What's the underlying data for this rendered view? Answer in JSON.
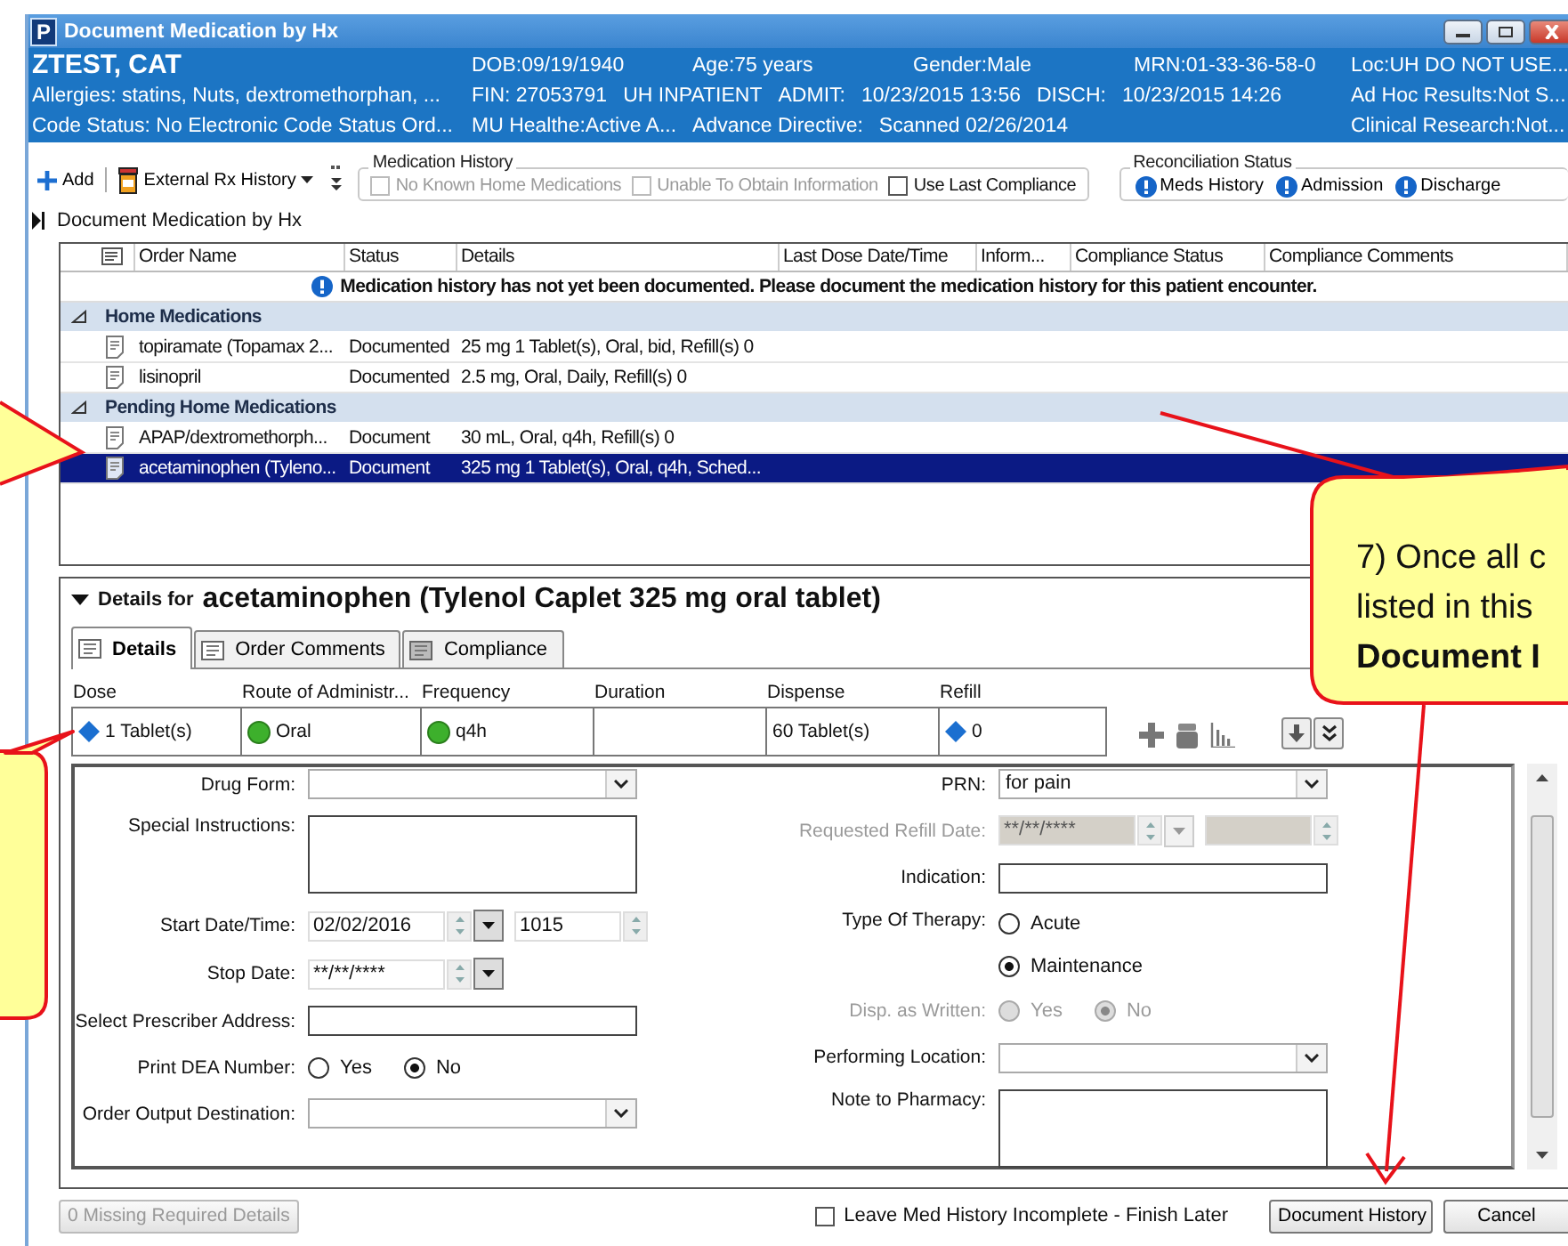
{
  "window": {
    "app_letter": "P",
    "title": "Document Medication by Hx"
  },
  "banner": {
    "rows": [
      {
        "left": "ZTEST, CAT",
        "items": [
          "DOB:09/19/1940",
          "Age:75 years",
          "Gender:Male",
          "MRN:01-33-36-58-0"
        ],
        "right": "Loc:UH DO NOT USE..."
      },
      {
        "left": "Allergies: statins, Nuts, dextromethorphan, ...",
        "items": [
          "FIN: 27053791",
          "UH INPATIENT",
          "ADMIT:",
          "10/23/2015 13:56",
          "DISCH:",
          "10/23/2015 14:26"
        ],
        "right": "Ad Hoc Results:Not S..."
      },
      {
        "left": "Code Status: No Electronic Code Status Ord...",
        "items": [
          "MU Healthe:Active A...",
          "Advance Directive:",
          "Scanned 02/26/2014"
        ],
        "right": "Clinical Research:Not..."
      }
    ]
  },
  "toolbar": {
    "add": "Add",
    "external": "External Rx History",
    "med_history": {
      "label": "Medication History",
      "options": [
        {
          "label": "No Known Home Medications",
          "checked": false,
          "disabled": true
        },
        {
          "label": "Unable To Obtain Information",
          "checked": false,
          "disabled": true
        },
        {
          "label": "Use Last Compliance",
          "checked": false,
          "disabled": false
        }
      ]
    },
    "reconciliation": {
      "label": "Reconciliation Status",
      "items": [
        "Meds History",
        "Admission",
        "Discharge"
      ]
    }
  },
  "breadcrumb": "Document Medication by Hx",
  "table": {
    "columns": [
      "Order Name",
      "Status",
      "Details",
      "Last Dose Date/Time",
      "Inform...",
      "Compliance Status",
      "Compliance Comments"
    ],
    "notice": "Medication history has not yet been documented. Please document the medication history for this patient encounter.",
    "groups": [
      {
        "name": "Home Medications",
        "expanded": true,
        "rows": [
          {
            "name": "topiramate (Topamax 2...",
            "status": "Documented",
            "details": "25 mg 1 Tablet(s), Oral, bid, Refill(s) 0",
            "selected": false
          },
          {
            "name": "lisinopril",
            "status": "Documented",
            "details": "2.5 mg, Oral, Daily, Refill(s) 0",
            "selected": false
          }
        ]
      },
      {
        "name": "Pending Home Medications",
        "expanded": true,
        "rows": [
          {
            "name": "APAP/dextromethorph...",
            "status": "Document",
            "details": "30 mL, Oral, q4h, Refill(s) 0",
            "selected": false
          },
          {
            "name": "acetaminophen (Tyleno...",
            "status": "Document",
            "details": "325 mg 1 Tablet(s), Oral, q4h, Sched...",
            "selected": true
          }
        ]
      }
    ]
  },
  "details": {
    "prefix": "Details for",
    "heading": "acetaminophen (Tylenol Caplet 325 mg oral tablet)",
    "tabs": [
      {
        "label": "Details",
        "selected": true
      },
      {
        "label": "Order Comments",
        "selected": false
      },
      {
        "label": "Compliance",
        "selected": false
      }
    ],
    "order_grid": [
      {
        "label": "Dose",
        "value": "1 Tablet(s)",
        "kind": "diamond"
      },
      {
        "label": "Route of Administr...",
        "value": "Oral",
        "kind": "dot"
      },
      {
        "label": "Frequency",
        "value": "q4h",
        "kind": "dot"
      },
      {
        "label": "Duration",
        "kind": "plain"
      },
      {
        "label": "Dispense",
        "value": "60 Tablet(s)",
        "kind": "plain"
      },
      {
        "label": "Refill",
        "value": "0",
        "kind": "diamond"
      }
    ],
    "form": {
      "left": [
        {
          "kind": "select",
          "label": "Drug Form:",
          "disabled": false
        },
        {
          "kind": "textarea",
          "label": "Special Instructions:",
          "disabled": false
        },
        {
          "kind": "datetime",
          "label": "Start Date/Time:",
          "value": "02/02/2016",
          "time": "1015",
          "disabled": false
        },
        {
          "kind": "date",
          "label": "Stop Date:",
          "value": "**/**/****",
          "disabled": false
        },
        {
          "kind": "text",
          "label": "Select Prescriber Address:",
          "disabled": false
        },
        {
          "kind": "radio",
          "label": "Print DEA Number:",
          "disabled": false,
          "options": [
            {
              "label": "Yes",
              "selected": false
            },
            {
              "label": "No",
              "selected": true
            }
          ]
        },
        {
          "kind": "select",
          "label": "Order Output Destination:",
          "disabled": false
        }
      ],
      "right": [
        {
          "kind": "select",
          "label": "PRN:",
          "value": "for pain",
          "disabled": false
        },
        {
          "kind": "datetime",
          "label": "Requested Refill Date:",
          "value": "**/**/****",
          "disabled": true
        },
        {
          "kind": "text",
          "label": "Indication:",
          "disabled": false
        },
        {
          "kind": "radio-stack",
          "label": "Type Of Therapy:",
          "disabled": false,
          "options": [
            {
              "label": "Acute",
              "selected": false
            },
            {
              "label": "Maintenance",
              "selected": true
            }
          ]
        },
        {
          "kind": "radio",
          "label": "Disp. as Written:",
          "disabled": true,
          "options": [
            {
              "label": "Yes",
              "selected": false
            },
            {
              "label": "No",
              "selected": true
            }
          ]
        },
        {
          "kind": "select",
          "label": "Performing Location:",
          "disabled": false
        },
        {
          "kind": "textarea",
          "label": "Note to Pharmacy:",
          "disabled": false
        }
      ]
    }
  },
  "footer": {
    "missing": "0 Missing Required Details",
    "leave": {
      "label": "Leave Med History Incomplete - Finish Later",
      "checked": false
    },
    "buttons": [
      "Document History",
      "Cancel"
    ]
  },
  "callout": {
    "lines": [
      {
        "text": "7) Once all c",
        "bold": false
      },
      {
        "text": "listed in this",
        "bold": false
      },
      {
        "text": "Document I",
        "bold": true
      }
    ]
  }
}
